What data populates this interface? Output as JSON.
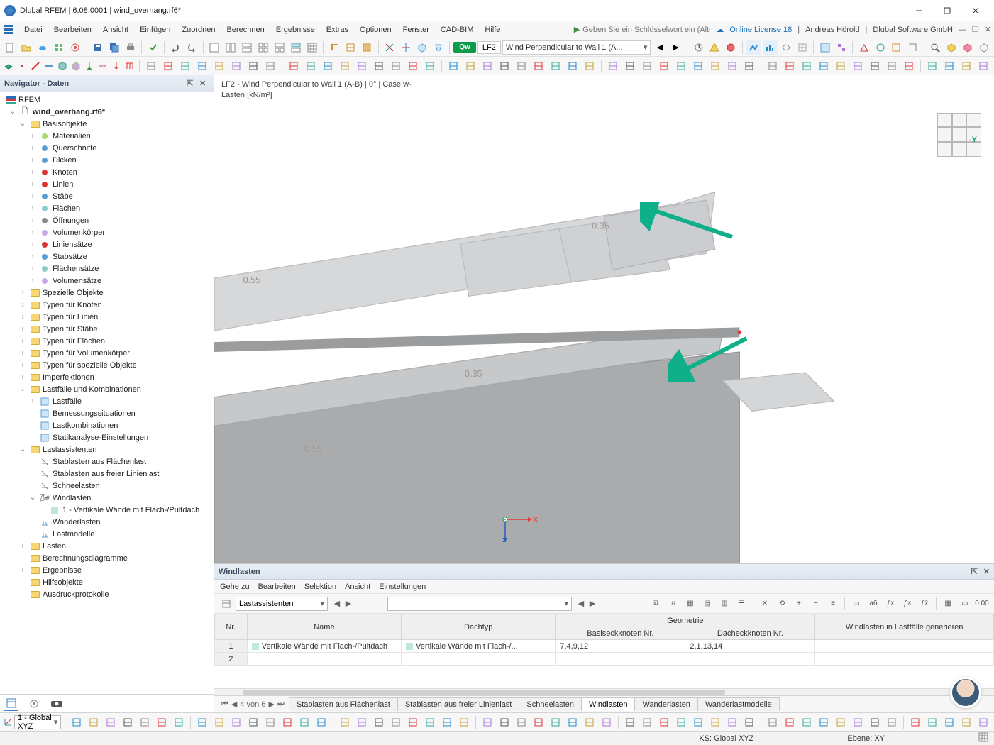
{
  "app": {
    "title": "Dlubal RFEM | 6.08.0001 | wind_overhang.rf6*"
  },
  "menu": {
    "items": [
      "Datei",
      "Bearbeiten",
      "Ansicht",
      "Einfügen",
      "Zuordnen",
      "Berechnen",
      "Ergebnisse",
      "Extras",
      "Optionen",
      "Fenster",
      "CAD-BIM",
      "Hilfe"
    ],
    "search_placeholder": "Geben Sie ein Schlüsselwort ein (Alt+Q)",
    "license": "Online License 18",
    "user": "Andreas Hörold",
    "company": "Dlubal Software GmbH"
  },
  "load_case": {
    "badge": "Qw",
    "num": "LF2",
    "name": "Wind Perpendicular to Wall 1 (A..."
  },
  "navigator": {
    "title": "Navigator - Daten",
    "root": "RFEM",
    "file": "wind_overhang.rf6*",
    "basis": "Basisobjekte",
    "basis_items": [
      "Materialien",
      "Querschnitte",
      "Dicken",
      "Knoten",
      "Linien",
      "Stäbe",
      "Flächen",
      "Öffnungen",
      "Volumenkörper",
      "Liniensätze",
      "Stabsätze",
      "Flächensätze",
      "Volumensätze"
    ],
    "groups1": [
      "Spezielle Objekte",
      "Typen für Knoten",
      "Typen für Linien",
      "Typen für Stäbe",
      "Typen für Flächen",
      "Typen für Volumenkörper",
      "Typen für spezielle Objekte",
      "Imperfektionen"
    ],
    "lc_group": "Lastfälle und Kombinationen",
    "lc_items": [
      "Lastfälle",
      "Bemessungssituationen",
      "Lastkombinationen",
      "Statikanalyse-Einstellungen"
    ],
    "la_group": "Lastassistenten",
    "la_items": [
      "Stablasten aus Flächenlast",
      "Stablasten aus freier Linienlast",
      "Schneelasten"
    ],
    "wind": "Windlasten",
    "wind_child": "1 - Vertikale Wände mit Flach-/Pultdach",
    "la_tail": [
      "Wanderlasten",
      "Lastmodelle"
    ],
    "groups2": [
      "Lasten",
      "Berechnungsdiagramme",
      "Ergebnisse",
      "Hilfsobjekte",
      "Ausdruckprotokolle"
    ]
  },
  "view": {
    "header_l1": "LF2 - Wind Perpendicular to Wall 1 (A-B) | 0° | Case w-",
    "header_l2": "Lasten [kN/m²]",
    "cube_label": "-Y",
    "labels": {
      "v1": "0.35",
      "v2": "0.55",
      "v3": "0.35",
      "v4": "0.55"
    },
    "axis": {
      "x": "x",
      "z": "z"
    }
  },
  "panel": {
    "title": "Windlasten",
    "menu": [
      "Gehe zu",
      "Bearbeiten",
      "Selektion",
      "Ansicht",
      "Einstellungen"
    ],
    "combo": "Lastassistenten",
    "page": "4 von 6",
    "tabs": [
      "Stablasten aus Flächenlast",
      "Stablasten aus freier Linienlast",
      "Schneelasten",
      "Windlasten",
      "Wanderlasten",
      "Wanderlastmodelle"
    ],
    "active_tab": 3,
    "table": {
      "group_header": "Geometrie",
      "cols": [
        "Nr.",
        "Name",
        "Dachtyp",
        "Basiseckknoten Nr.",
        "Dacheckknoten Nr.",
        "Windlasten in Lastfälle generieren"
      ],
      "rows": [
        {
          "nr": "1",
          "name": "Vertikale Wände mit Flach-/Pultdach",
          "dachtyp": "Vertikale Wände mit Flach-/...",
          "basis": "7,4,9,12",
          "dach": "2,1,13,14",
          "gen": ""
        },
        {
          "nr": "2",
          "name": "",
          "dachtyp": "",
          "basis": "",
          "dach": "",
          "gen": ""
        }
      ]
    }
  },
  "bottom_bar": {
    "cs": "1 - Global XYZ"
  },
  "status": {
    "ks": "KS: Global XYZ",
    "ebene": "Ebene: XY"
  },
  "colors": {
    "arrow": "#0fb089"
  }
}
